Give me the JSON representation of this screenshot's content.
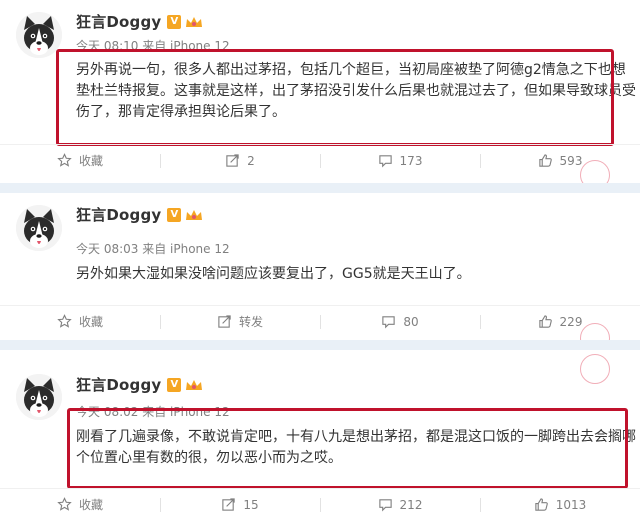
{
  "posts": [
    {
      "username": "狂言Doggy",
      "verified_badge": "V",
      "meta": "今天 08:10 来自 iPhone 12",
      "text": "另外再说一句，很多人都出过茅招，包括几个超巨，当初局座被垫了阿德g2情急之下也想垫杜兰特报复。这事就是这样，出了茅招没引发什么后果也就混过去了，但如果导致球员受伤了，那肯定得承担舆论后果了。",
      "actions": {
        "favorite": "收藏",
        "repost": "2",
        "comment": "173",
        "like": "593"
      }
    },
    {
      "username": "狂言Doggy",
      "verified_badge": "V",
      "meta": "今天 08:03 来自 iPhone 12",
      "text": "另外如果大湿如果没啥问题应该要复出了，GG5就是天王山了。",
      "actions": {
        "favorite": "收藏",
        "repost": "转发",
        "comment": "80",
        "like": "229"
      }
    },
    {
      "username": "狂言Doggy",
      "verified_badge": "V",
      "meta": "今天 08:02 来自 iPhone 12",
      "text": "刚看了几遍录像，不敢说肯定吧，十有八九是想出茅招，都是混这口饭的一脚跨出去会搁哪个位置心里有数的很，勿以恶小而为之哎。",
      "actions": {
        "favorite": "收藏",
        "repost": "15",
        "comment": "212",
        "like": "1013"
      }
    }
  ],
  "icons": {
    "favorite": "star-icon",
    "repost": "repost-icon",
    "comment": "comment-icon",
    "like": "thumbs-up-icon"
  },
  "colors": {
    "highlight_box": "#c0122c",
    "verified": "#f5a623",
    "username": "#333333",
    "meta": "#808080",
    "feed_background": "#e9f0f7"
  }
}
